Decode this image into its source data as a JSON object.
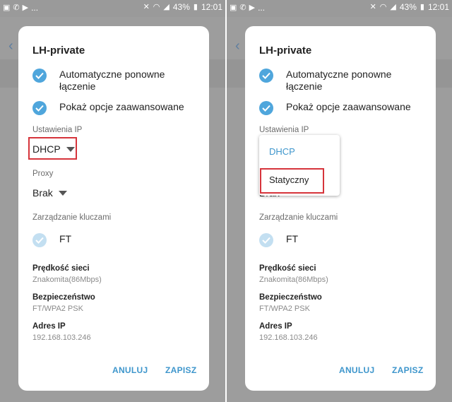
{
  "status_bar": {
    "battery": "43%",
    "time": "12:01",
    "left_icons": [
      "gallery-icon",
      "whatsapp-icon",
      "play-icon"
    ],
    "more": "..."
  },
  "dialog": {
    "title": "LH-private",
    "checks": [
      {
        "line1": "Automatyczne ponowne",
        "line2": "łączenie"
      },
      {
        "line1": "Pokaż opcje zaawansowane",
        "line2": ""
      }
    ],
    "ip_settings_label": "Ustawienia IP",
    "ip_settings_value": "DHCP",
    "proxy_label": "Proxy",
    "proxy_value": "Brak",
    "key_mgmt_label": "Zarządzanie kluczami",
    "key_mgmt_value": "FT",
    "speed_title": "Prędkość sieci",
    "speed_value": "Znakomita(86Mbps)",
    "security_title": "Bezpieczeństwo",
    "security_value": "FT/WPA2 PSK",
    "ip_title": "Adres IP",
    "ip_value": "192.168.103.246",
    "cancel_label": "ANULUJ",
    "save_label": "ZAPISZ"
  },
  "dropdown": {
    "options": [
      "DHCP",
      "Statyczny"
    ],
    "selected": "DHCP",
    "partial_below": "Brak"
  },
  "colors": {
    "accent": "#3e96cc",
    "highlight": "#d6343b",
    "check": "#4fa6dc"
  }
}
